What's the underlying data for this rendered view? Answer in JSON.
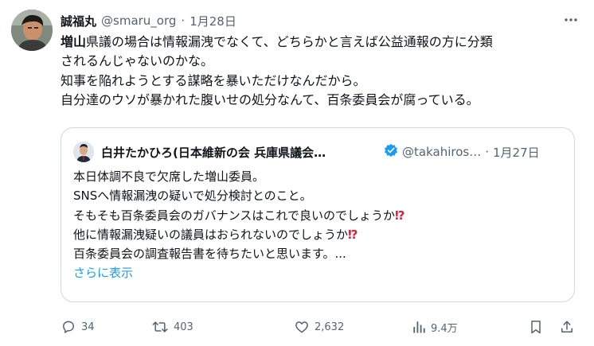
{
  "tweet": {
    "author_name": "誠福丸",
    "handle": "@smaru_org",
    "separator": "·",
    "date": "1月28日",
    "lines": [
      {
        "bold": "増山",
        "rest": "県議の場合は情報漏洩でなくて、どちらかと言えば公益通報の方に分類"
      },
      {
        "bold": "",
        "rest": "されるんじゃないのかな。"
      },
      {
        "bold": "",
        "rest": "知事を陥れようとする謀略を暴いただけなんだから。"
      },
      {
        "bold": "",
        "rest": "自分達のウソが暴かれた腹いせの処分なんて、百条委員会が腐っている。"
      }
    ]
  },
  "quote": {
    "author_name": "白井たかひろ(日本維新の会 兵庫県議会…",
    "handle": "@takahiros…",
    "separator": "·",
    "date": "1月27日",
    "lines": [
      {
        "text": "本日体調不良で欠席した増山委員。",
        "emoji": ""
      },
      {
        "text": "SNSへ情報漏洩の疑いで処分検討とのこと。",
        "emoji": ""
      },
      {
        "text": "そもそも百条委員会のガバナンスはこれで良いのでしょうか",
        "emoji": "⁉"
      },
      {
        "text": "他に情報漏洩疑いの議員はおられないのでしょうか",
        "emoji": "⁉"
      },
      {
        "text": "百条委員会の調査報告書を待ちたいと思います。...",
        "emoji": ""
      }
    ],
    "show_more": "さらに表示"
  },
  "actions": {
    "reply_count": "34",
    "retweet_count": "403",
    "like_count": "2,632",
    "view_count": "9.4万"
  },
  "icons": {
    "more": "more-icon",
    "verified": "verified-badge-icon",
    "reply": "reply-icon",
    "retweet": "retweet-icon",
    "like": "like-icon",
    "views": "views-icon",
    "bookmark": "bookmark-icon",
    "share": "share-icon"
  },
  "colors": {
    "text": "#0f1419",
    "muted": "#536471",
    "link": "#1d9bf0",
    "border": "#cfd9de",
    "emoji": "#d8213c"
  }
}
